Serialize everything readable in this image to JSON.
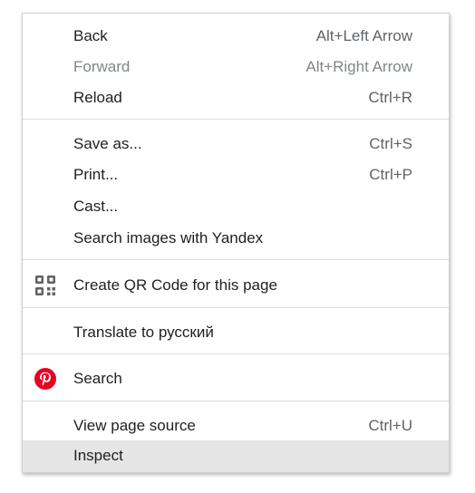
{
  "menu": {
    "items": [
      {
        "label": "Back",
        "shortcut": "Alt+Left Arrow"
      },
      {
        "label": "Forward",
        "shortcut": "Alt+Right Arrow"
      },
      {
        "label": "Reload",
        "shortcut": "Ctrl+R"
      },
      {
        "label": "Save as...",
        "shortcut": "Ctrl+S"
      },
      {
        "label": "Print...",
        "shortcut": "Ctrl+P"
      },
      {
        "label": "Cast..."
      },
      {
        "label": "Search images with Yandex"
      },
      {
        "label": "Create QR Code for this page",
        "icon": "qr-code-icon"
      },
      {
        "label": "Translate to русский"
      },
      {
        "label": "Search",
        "icon": "pinterest-icon"
      },
      {
        "label": "View page source",
        "shortcut": "Ctrl+U"
      },
      {
        "label": "Inspect"
      }
    ],
    "highlight_color": "#e5e5e5",
    "pinterest_color": "#e60023",
    "disabled_items": [
      "Forward"
    ],
    "highlighted_item": "Inspect"
  }
}
